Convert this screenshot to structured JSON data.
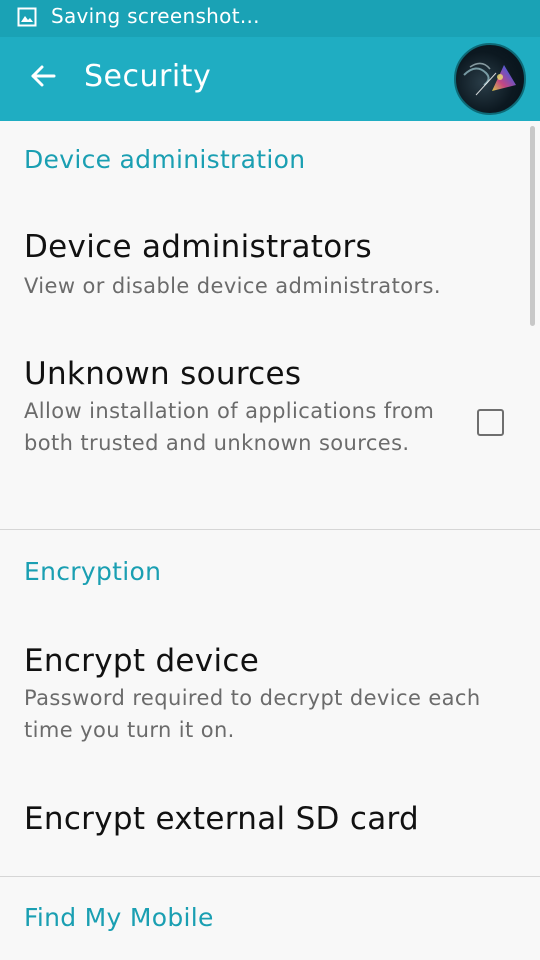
{
  "status_bar": {
    "text": "Saving screenshot...",
    "icon": "image-icon"
  },
  "app_bar": {
    "title": "Security",
    "back_icon": "arrow-left-icon",
    "avatar": "profile-avatar"
  },
  "sections": [
    {
      "header": "Device administration",
      "items": [
        {
          "title": "Device administrators",
          "summary": "View or disable device administrators."
        },
        {
          "title": "Unknown sources",
          "summary": "Allow installation of applications from both trusted and unknown sources.",
          "checked": false
        }
      ]
    },
    {
      "header": "Encryption",
      "items": [
        {
          "title": "Encrypt device",
          "summary": "Password required to decrypt device each time you turn it on."
        },
        {
          "title": "Encrypt external SD card"
        }
      ]
    },
    {
      "header": "Find My Mobile"
    }
  ],
  "colors": {
    "status_bar": "#1aa2b5",
    "app_bar": "#1fadc2",
    "accent": "#1a9fb2",
    "background": "#f8f8f8"
  }
}
